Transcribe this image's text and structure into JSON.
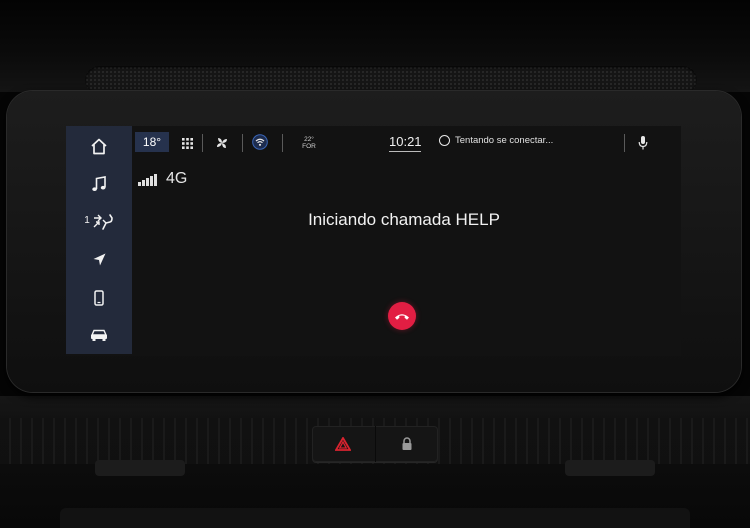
{
  "colors": {
    "sidebar_bg": "#232a3b",
    "temp_chip_bg": "#26324d",
    "end_call": "#e21e43",
    "hazard": "#d8232f"
  },
  "sidebar": {
    "items": [
      {
        "name": "home",
        "icon": "home-icon"
      },
      {
        "name": "media",
        "icon": "music-note-icon"
      },
      {
        "name": "climate",
        "icon": "seat-airflow-icon",
        "zone_label": "1"
      },
      {
        "name": "navigation",
        "icon": "navigation-arrow-icon"
      },
      {
        "name": "phone",
        "icon": "phone-icon"
      },
      {
        "name": "vehicle",
        "icon": "car-icon"
      }
    ]
  },
  "status_bar": {
    "temperature": "18°",
    "cabin_temp": "22°",
    "cabin_label": "FOR",
    "time": "10:21",
    "assistant_text": "Tentando se conectar..."
  },
  "network": {
    "label": "4G",
    "bars": 4
  },
  "call": {
    "title": "Iniciando chamada HELP"
  }
}
